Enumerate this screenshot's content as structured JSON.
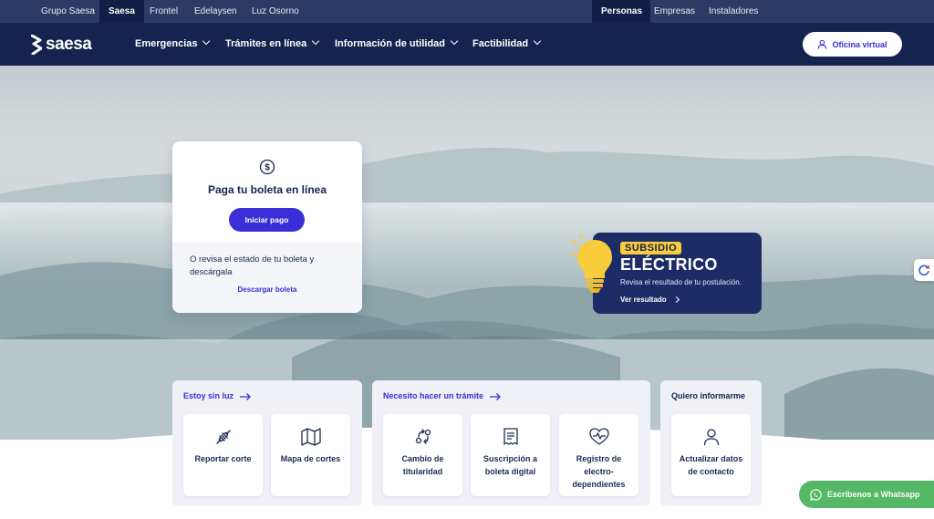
{
  "topbar": {
    "brands": [
      "Grupo Saesa",
      "Saesa",
      "Frontel",
      "Edelaysen",
      "Luz Osorno"
    ],
    "active_brand": "Saesa",
    "segments": [
      "Personas",
      "Empresas",
      "Instaladores"
    ],
    "active_segment": "Personas"
  },
  "nav": {
    "logo": "saesa",
    "items": [
      "Emergencias",
      "Trámites en línea",
      "Información de utilidad",
      "Factibilidad"
    ],
    "virtual_office": "Oficina virtual"
  },
  "pay_card": {
    "icon": "dollar-circle-icon",
    "title": "Paga tu boleta en línea",
    "button": "Iniciar pago",
    "description": "O revisa el estado de tu boleta y descárgala",
    "link": "Descargar boleta"
  },
  "subsidy": {
    "tag": "SUBSIDIO",
    "title": "ELÉCTRICO",
    "description": "Revisa el resultado de tu postulación.",
    "link": "Ver resultado"
  },
  "sections": [
    {
      "header": "Estoy sin luz",
      "tiles": [
        {
          "label": "Reportar corte",
          "icon": "plug-icon"
        },
        {
          "label": "Mapa de cortes",
          "icon": "map-icon"
        }
      ]
    },
    {
      "header": "Necesito hacer un trámite",
      "tiles": [
        {
          "label": "Cambio de titularidad",
          "icon": "transfer-icon"
        },
        {
          "label": "Suscripción a boleta digital",
          "icon": "receipt-icon"
        },
        {
          "label": "Registro de electro-dependientes",
          "icon": "heart-pulse-icon"
        }
      ]
    },
    {
      "header": "Quiero informarme",
      "tiles": [
        {
          "label": "Actualizar datos de contacto",
          "icon": "user-icon"
        }
      ]
    }
  ],
  "whatsapp": "Escríbenos a Whatsapp",
  "colors": {
    "navy": "#14244f",
    "topbar": "#2b3b64",
    "accent": "#3a2fd6",
    "subsidy_yellow": "#f9cc3b",
    "whatsapp_green": "#55b866"
  }
}
